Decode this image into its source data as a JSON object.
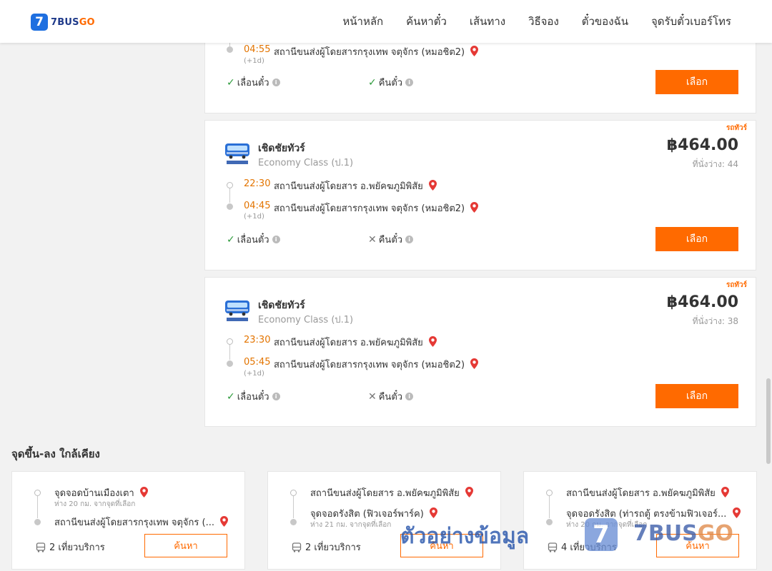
{
  "header": {
    "logo_mark": "7",
    "logo_brand": "7BUS",
    "logo_brand_accent": "GO",
    "nav": [
      "หน้าหลัก",
      "ค้นหาตั๋ว",
      "เส้นทาง",
      "วิธีจอง",
      "ตั๋วของฉัน",
      "จุดรับตั๋วเบอร์โทร"
    ]
  },
  "top_card": {
    "arrive_time": "04:55",
    "arrive_station": "สถานีขนส่งผู้โดยสารกรุงเทพ จตุจักร (หมอชิต2)",
    "next_day": "(+1d)",
    "reschedule": "เลื่อนตั๋ว",
    "refund": "คืนตั๋ว",
    "button": "เลือก"
  },
  "trips": [
    {
      "label": "รถทัวร์",
      "operator": "เชิดชัยทัวร์",
      "class": "Economy Class (ป.1)",
      "price": "฿464.00",
      "seats": "ที่นั่งว่าง: 44",
      "depart_time": "22:30",
      "depart_station": "สถานีขนส่งผู้โดยสาร อ.พยัคฆภูมิพิสัย",
      "arrive_time": "04:45",
      "arrive_station": "สถานีขนส่งผู้โดยสารกรุงเทพ จตุจักร (หมอชิต2)",
      "next_day": "(+1d)",
      "reschedule": "เลื่อนตั๋ว",
      "refund": "คืนตั๋ว",
      "button": "เลือก"
    },
    {
      "label": "รถทัวร์",
      "operator": "เชิดชัยทัวร์",
      "class": "Economy Class (ป.1)",
      "price": "฿464.00",
      "seats": "ที่นั่งว่าง: 38",
      "depart_time": "23:30",
      "depart_station": "สถานีขนส่งผู้โดยสาร อ.พยัคฆภูมิพิสัย",
      "arrive_time": "05:45",
      "arrive_station": "สถานีขนส่งผู้โดยสารกรุงเทพ จตุจักร (หมอชิต2)",
      "next_day": "(+1d)",
      "reschedule": "เลื่อนตั๋ว",
      "refund": "คืนตั๋ว",
      "button": "เลือก"
    }
  ],
  "nearby": {
    "title": "จุดขึ้น-ลง ใกล้เคียง",
    "cards": [
      {
        "from": "จุดจอดบ้านเมืองเตา",
        "from_dist": "ห่าง 20 กม. จากจุดที่เลือก",
        "to": "สถานีขนส่งผู้โดยสารกรุงเทพ จตุจักร (...",
        "to_dist": "",
        "trips": "2 เที่ยวบริการ",
        "button": "ค้นหา"
      },
      {
        "from": "สถานีขนส่งผู้โดยสาร อ.พยัคฆภูมิพิสัย",
        "from_dist": "",
        "to": "จุดจอดรังสิต (ฟิวเจอร์พาร์ค)",
        "to_dist": "ห่าง 21 กม. จากจุดที่เลือก",
        "trips": "2 เที่ยวบริการ",
        "button": "ค้นหา"
      },
      {
        "from": "สถานีขนส่งผู้โดยสาร อ.พยัคฆภูมิพิสัย",
        "from_dist": "",
        "to": "จุดจอดรังสิต (ท่ารถตู้ ตรงข้ามฟิวเจอร์...",
        "to_dist": "ห่าง 20 กม. จากจุดที่เลือก",
        "trips": "4 เที่ยวบริการ",
        "button": "ค้นหา"
      }
    ]
  },
  "watermark": {
    "text": "ตัวอย่างข้อมูล",
    "mark": "7",
    "brand": "7BUS",
    "brand_accent": "GO"
  },
  "colors": {
    "accent": "#ff6a00",
    "time": "#e37400",
    "brand_blue": "#1e6fe0",
    "pin": "#e53935",
    "check": "#2e9b3c"
  }
}
